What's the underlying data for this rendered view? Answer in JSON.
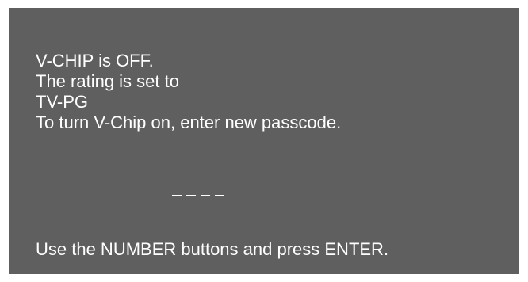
{
  "dialog": {
    "status": "V-CHIP is OFF.",
    "rating_intro": "The rating is set to",
    "rating_value": "TV-PG",
    "instruction": "To turn V-Chip on, enter new passcode.",
    "passcode_slots": [
      "",
      "",
      "",
      ""
    ],
    "footer_hint": "Use the NUMBER buttons and press ENTER."
  },
  "colors": {
    "panel_background": "#5f5f5f",
    "text": "#ffffff",
    "page_background": "#ffffff"
  }
}
